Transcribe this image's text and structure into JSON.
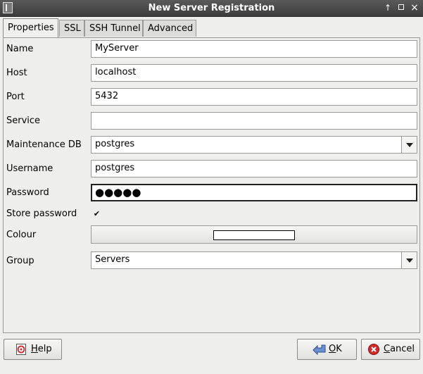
{
  "window": {
    "title": "New Server Registration"
  },
  "tabs": [
    {
      "label": "Properties"
    },
    {
      "label": "SSL"
    },
    {
      "label": "SSH Tunnel"
    },
    {
      "label": "Advanced"
    }
  ],
  "form": {
    "name": {
      "label": "Name",
      "value": "MyServer"
    },
    "host": {
      "label": "Host",
      "value": "localhost"
    },
    "port": {
      "label": "Port",
      "value": "5432"
    },
    "service": {
      "label": "Service",
      "value": ""
    },
    "maintenance_db": {
      "label": "Maintenance DB",
      "value": "postgres"
    },
    "username": {
      "label": "Username",
      "value": "postgres"
    },
    "password": {
      "label": "Password",
      "masked": "●●●●●"
    },
    "store_password": {
      "label": "Store password",
      "checked": true,
      "mark": "✔"
    },
    "colour": {
      "label": "Colour",
      "swatch": "#ffffff"
    },
    "group": {
      "label": "Group",
      "value": "Servers"
    }
  },
  "buttons": {
    "help_first": "H",
    "help_rest": "elp",
    "ok_first": "O",
    "ok_rest": "K",
    "cancel_first": "C",
    "cancel_rest": "ancel"
  }
}
